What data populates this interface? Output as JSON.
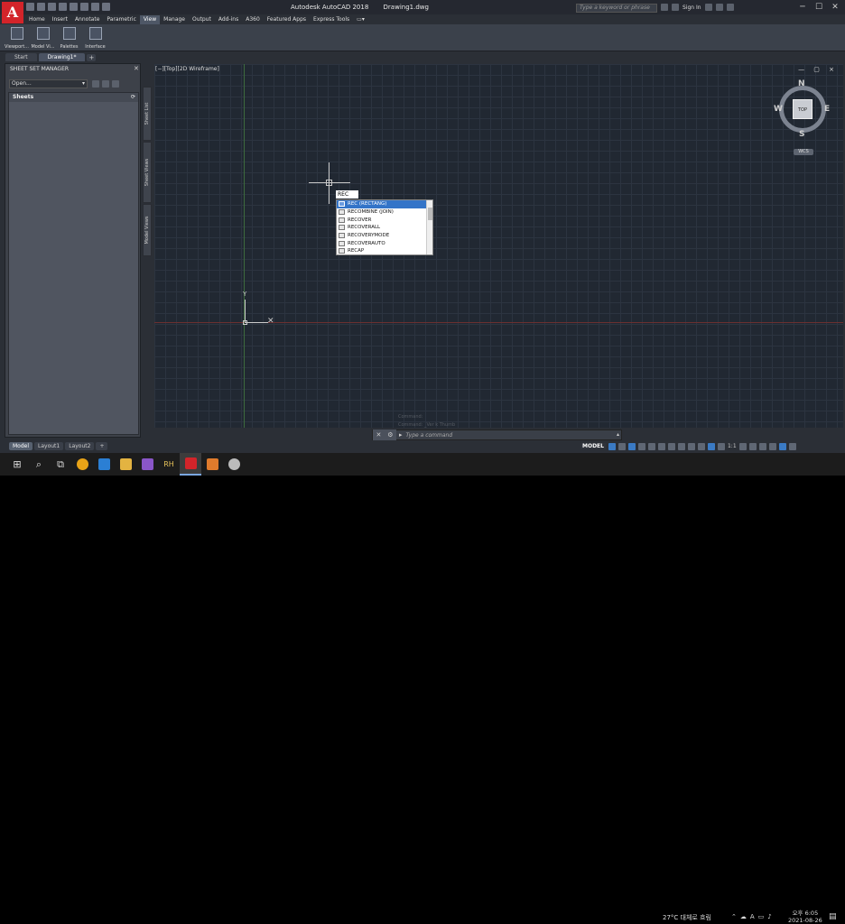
{
  "app": {
    "title": "Autodesk AutoCAD 2018",
    "filename": "Drawing1.dwg",
    "logo_letter": "A",
    "search_placeholder": "Type a keyword or phrase",
    "sign_in": "Sign In"
  },
  "ribbon_tabs": [
    "Home",
    "Insert",
    "Annotate",
    "Parametric",
    "View",
    "Manage",
    "Output",
    "Add-ins",
    "A360",
    "Featured Apps",
    "Express Tools"
  ],
  "active_ribbon_tab": "View",
  "ribbon_panels": [
    {
      "label": "Viewport..."
    },
    {
      "label": "Model Vi..."
    },
    {
      "label": "Palettes"
    },
    {
      "label": "Interface"
    }
  ],
  "doc_tabs": [
    "Start",
    "Drawing1*"
  ],
  "sheet_set_manager": {
    "title": "SHEET SET MANAGER",
    "select_value": "Open...",
    "sheets_header": "Sheets",
    "vertical_tabs": [
      "Sheet List",
      "Sheet Views",
      "Model Views"
    ]
  },
  "viewport": {
    "label": "[−][Top][2D Wireframe]",
    "controls": "— ▢ ×",
    "ucs_y": "Y",
    "ucs_x": "✕"
  },
  "dynamic_input": "REC",
  "autocomplete": [
    "REC (RECTANG)",
    "RECOMBINE (JOIN)",
    "RECOVER",
    "RECOVERALL",
    "RECOVERYMODE",
    "RECOVERAUTO",
    "RECAP"
  ],
  "viewcube": {
    "top": "TOP",
    "north": "N",
    "south": "S",
    "east": "E",
    "west": "W",
    "wcs": "WCS"
  },
  "command_line": {
    "history": [
      "Command:",
      "Command: _Ver k Thumb"
    ],
    "prompt": "Type a command"
  },
  "layout_tabs": [
    "Model",
    "Layout1",
    "Layout2"
  ],
  "status": {
    "model": "MODEL",
    "scale": "1:1"
  },
  "taskbar": {
    "weather": "27°C 대체로 흐림",
    "time": "오후 6:05",
    "date": "2021-08-26",
    "lang": "A"
  },
  "colors": {
    "logo": "#d3242a",
    "canvas": "#212832",
    "selection": "#3374c8"
  }
}
